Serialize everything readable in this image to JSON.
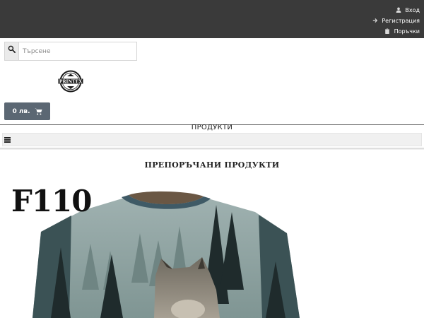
{
  "header": {
    "links": [
      {
        "label": "Вход",
        "icon": "user-icon"
      },
      {
        "label": "Регистрация",
        "icon": "arrow-right-icon"
      },
      {
        "label": "Поръчки",
        "icon": "clipboard-icon"
      }
    ]
  },
  "search": {
    "placeholder": "Търсене",
    "value": ""
  },
  "logo": {
    "text": "PRINTEX"
  },
  "cart": {
    "label": "0 лв.",
    "icon": "cart-icon"
  },
  "nav": {
    "title": "ПРОДУКТИ",
    "menu_icon": "hamburger-menu-icon"
  },
  "featured": {
    "title": "ПРЕПОРЪЧАНИ ПРОДУКТИ",
    "product": {
      "code": "F110"
    }
  },
  "colors": {
    "topbar": "#3a3a3a",
    "cart_button": "#5b6773",
    "shirt_collar": "#3f5a66"
  }
}
